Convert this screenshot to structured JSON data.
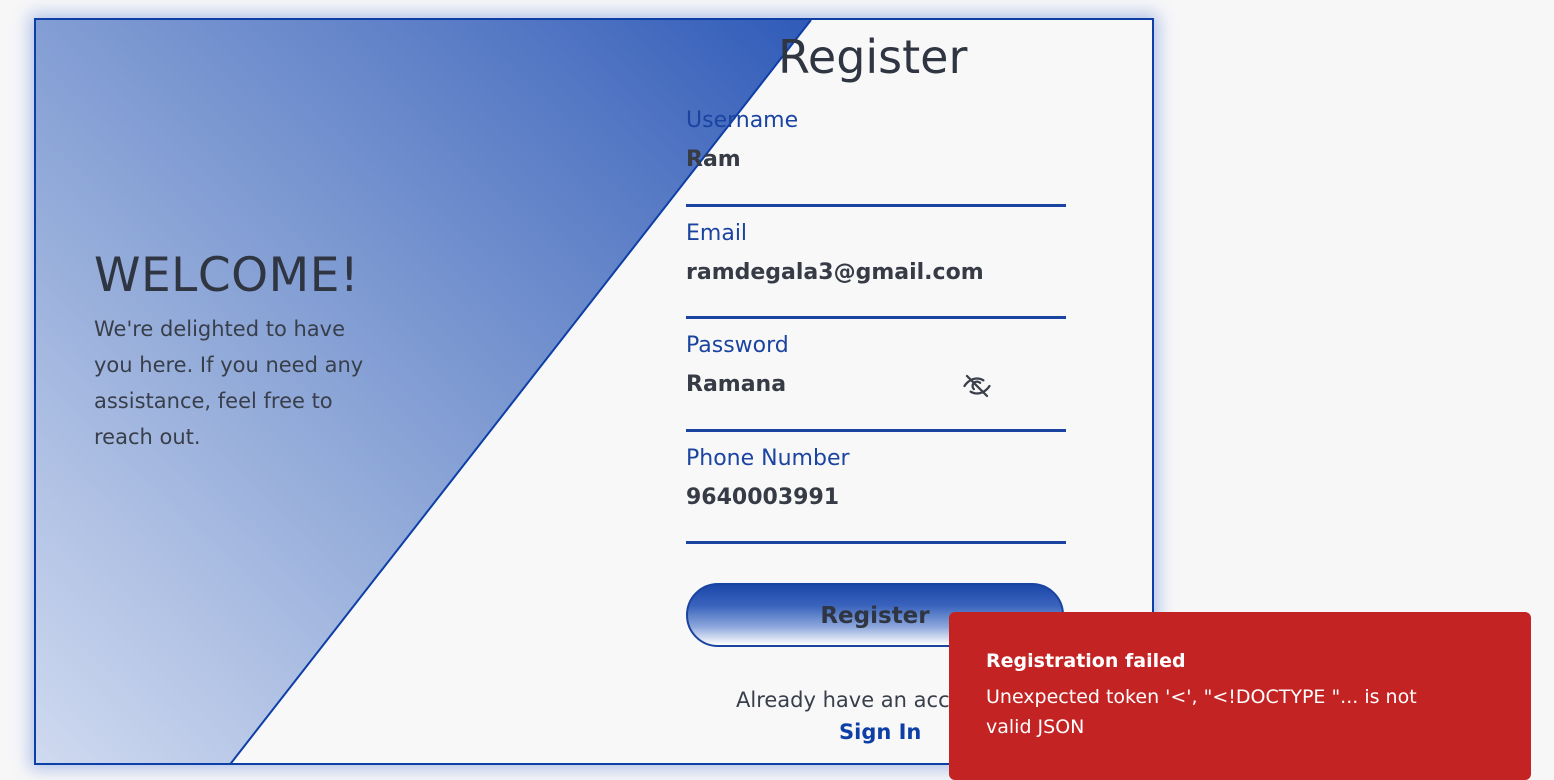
{
  "welcome": {
    "heading": "WELCOME!",
    "message": "We're delighted to have you here. If you need any assistance, feel free to reach out."
  },
  "form": {
    "title": "Register",
    "fields": [
      {
        "label": "Username",
        "value": "Ram"
      },
      {
        "label": "Email",
        "value": "ramdegala3@gmail.com"
      },
      {
        "label": "Password",
        "value": "Ramana",
        "icon": "eye-off-icon"
      },
      {
        "label": "Phone Number",
        "value": "9640003991"
      }
    ],
    "submit_label": "Register",
    "already_text": "Already have an account?",
    "signin_label": "Sign In"
  },
  "toast": {
    "title": "Registration failed",
    "message": "Unexpected token '<', \"<!DOCTYPE \"... is not valid JSON"
  },
  "colors": {
    "accent": "#1a44a0",
    "toast_bg": "#c42323"
  }
}
